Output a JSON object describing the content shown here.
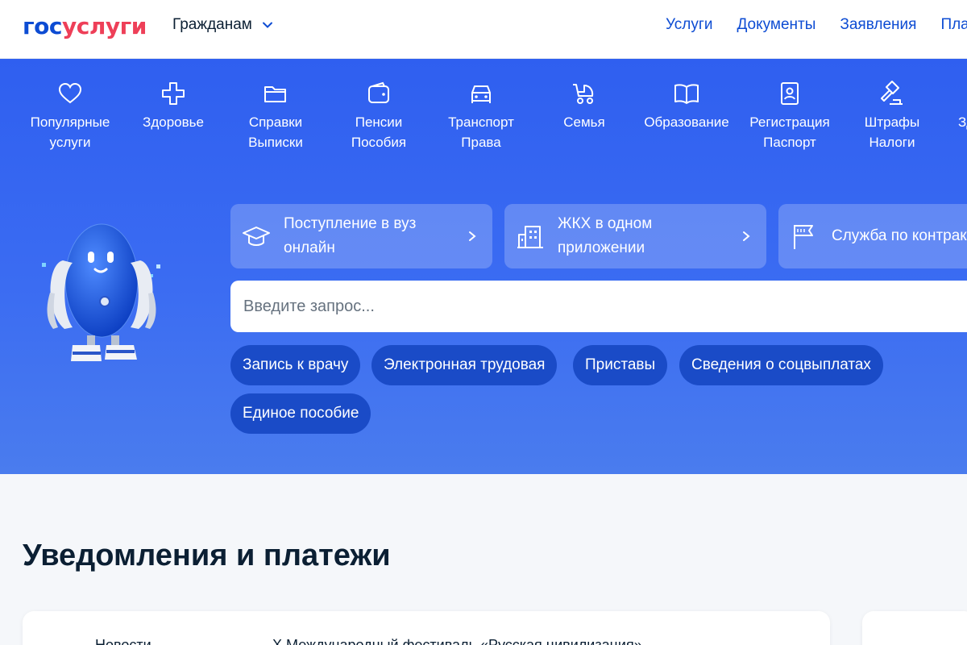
{
  "header": {
    "logo_part1": "гос",
    "logo_part2": "услуги",
    "audience_label": "Гражданам",
    "nav": [
      "Услуги",
      "Документы",
      "Заявления",
      "Платежи"
    ]
  },
  "categories": [
    {
      "icon": "heart-icon",
      "line1": "Популярные",
      "line2": "услуги"
    },
    {
      "icon": "health-cross-icon",
      "line1": "Здоровье",
      "line2": ""
    },
    {
      "icon": "folder-icon",
      "line1": "Справки",
      "line2": "Выписки"
    },
    {
      "icon": "wallet-icon",
      "line1": "Пенсии",
      "line2": "Пособия"
    },
    {
      "icon": "car-icon",
      "line1": "Транспорт",
      "line2": "Права"
    },
    {
      "icon": "stroller-icon",
      "line1": "Семья",
      "line2": ""
    },
    {
      "icon": "book-icon",
      "line1": "Образование",
      "line2": ""
    },
    {
      "icon": "id-card-icon",
      "line1": "Регистрация",
      "line2": "Паспорт"
    },
    {
      "icon": "gavel-icon",
      "line1": "Штрафы",
      "line2": "Налоги"
    },
    {
      "icon": "more-icon",
      "line1": "Здоровье",
      "line2": ""
    }
  ],
  "promos": [
    {
      "icon": "graduation-cap-icon",
      "text": "Поступление в вуз онлайн"
    },
    {
      "icon": "building-icon",
      "text": "ЖКХ в одном приложении"
    },
    {
      "icon": "flag-icon",
      "text": "Служба по контракту"
    }
  ],
  "search": {
    "placeholder": "Введите запрос..."
  },
  "chips": [
    "Запись к врачу",
    "Электронная трудовая",
    "Приставы",
    "Сведения о соцвыплатах",
    "Единое пособие"
  ],
  "notifications": {
    "title": "Уведомления и платежи",
    "row_label": "Новости",
    "row_text": "X Международный фестиваль «Русская цивилизация»"
  },
  "colors": {
    "brand_blue": "#0d4cd3",
    "brand_red": "#ee3f58",
    "hero": "#3b6cf2",
    "chip": "#1a4bc7"
  }
}
